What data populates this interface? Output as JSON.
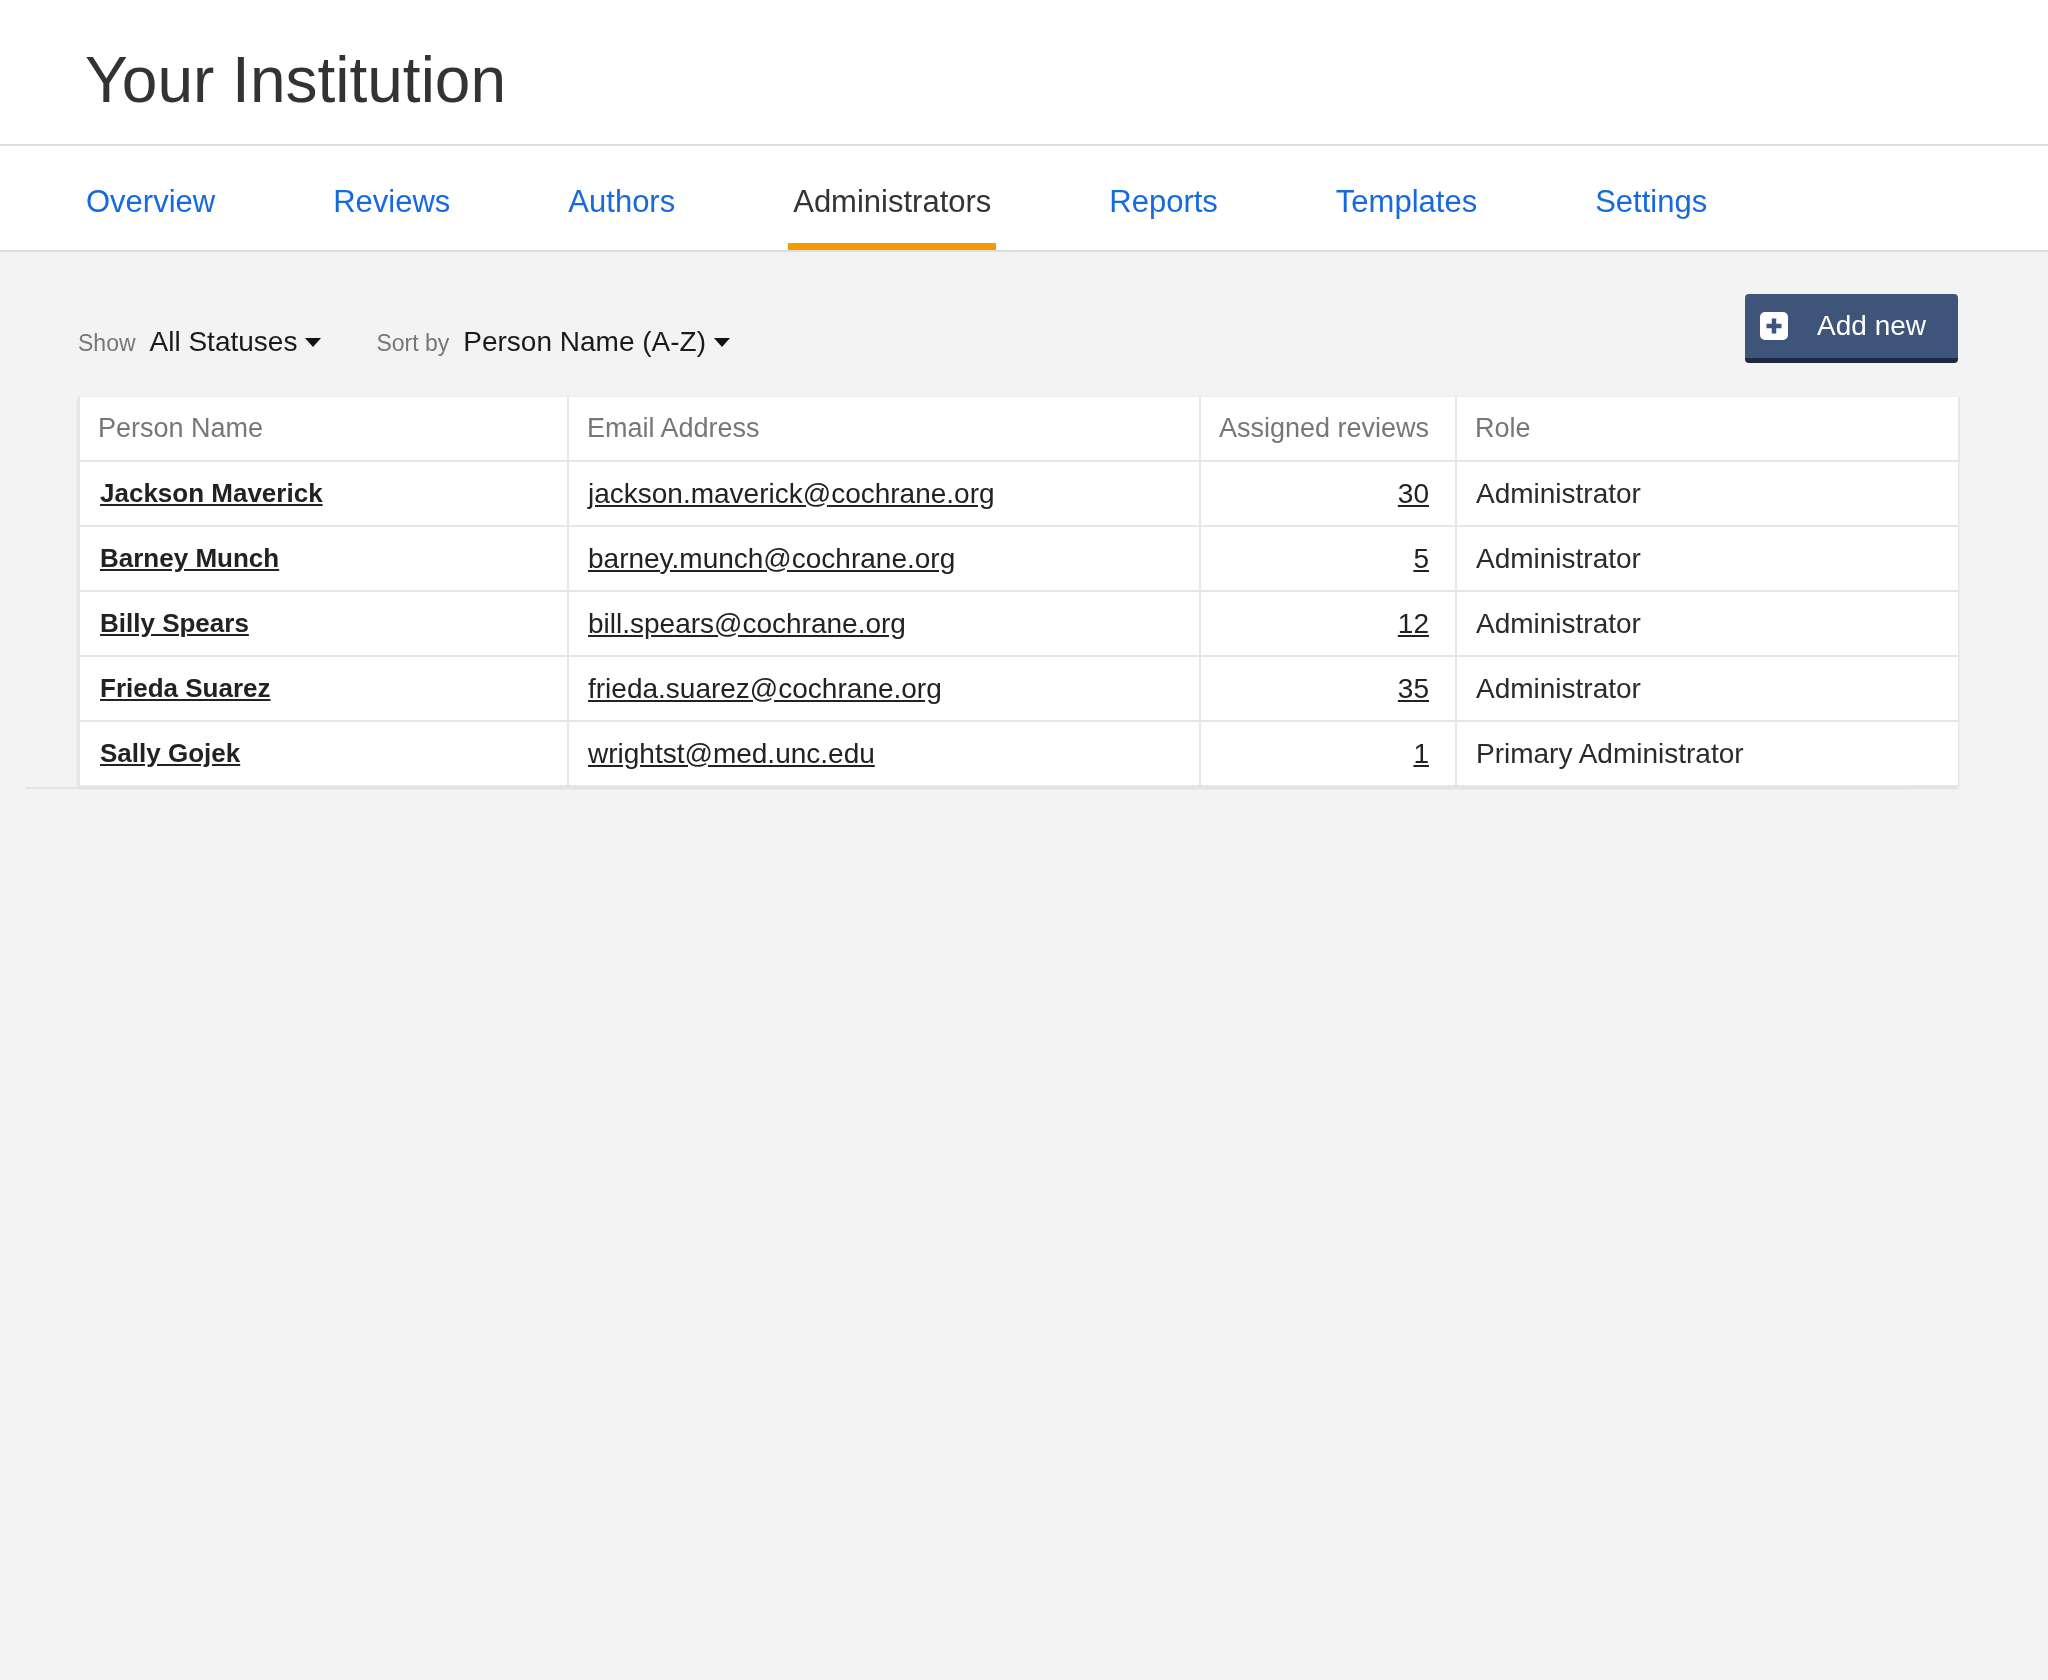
{
  "header": {
    "title": "Your Institution"
  },
  "tabs": [
    {
      "label": "Overview",
      "selected": false
    },
    {
      "label": "Reviews",
      "selected": false
    },
    {
      "label": "Authors",
      "selected": false
    },
    {
      "label": "Administrators",
      "selected": true
    },
    {
      "label": "Reports",
      "selected": false
    },
    {
      "label": "Templates",
      "selected": false
    },
    {
      "label": "Settings",
      "selected": false
    }
  ],
  "toolbar": {
    "filters": [
      {
        "label": "Show",
        "value": "All Statuses"
      },
      {
        "label": "Sort by",
        "value": "Person Name (A-Z)"
      }
    ],
    "add_button": {
      "label": "Add new"
    }
  },
  "table": {
    "columns": [
      "Person Name",
      "Email Address",
      "Assigned reviews",
      "Role"
    ],
    "rows": [
      {
        "name": "Jackson Maverick",
        "email": "jackson.maverick@cochrane.org",
        "assigned_reviews": "30",
        "role": "Administrator"
      },
      {
        "name": "Barney Munch",
        "email": "barney.munch@cochrane.org",
        "assigned_reviews": "5",
        "role": "Administrator"
      },
      {
        "name": "Billy Spears",
        "email": "bill.spears@cochrane.org",
        "assigned_reviews": "12",
        "role": "Administrator"
      },
      {
        "name": "Frieda Suarez",
        "email": "frieda.suarez@cochrane.org",
        "assigned_reviews": "35",
        "role": "Administrator"
      },
      {
        "name": "Sally Gojek",
        "email": "wrightst@med.unc.edu",
        "assigned_reviews": "1",
        "role": "Primary Administrator"
      }
    ]
  }
}
